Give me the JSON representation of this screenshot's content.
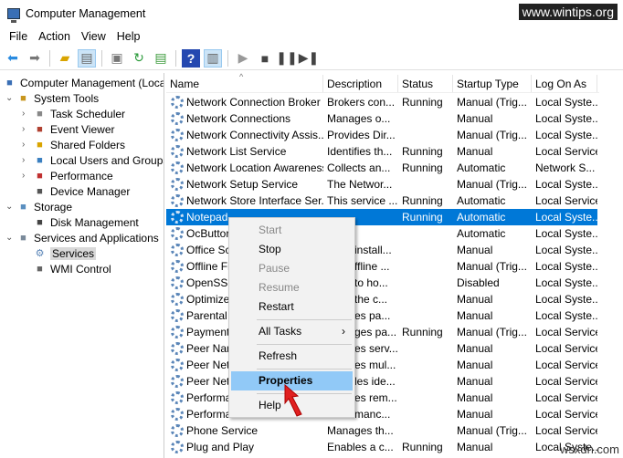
{
  "window": {
    "title": "Computer Management",
    "watermark": "www.wintips.org",
    "watermark2": "wsxdn.com"
  },
  "menubar": [
    "File",
    "Action",
    "View",
    "Help"
  ],
  "toolbar": [
    "back-icon",
    "forward-icon",
    "up-folder-icon",
    "show-hide-tree-icon",
    "export-icon",
    "refresh-icon",
    "export-list-icon",
    "help-icon",
    "show-action-pane-icon",
    "play-icon",
    "stop-icon",
    "pause-icon",
    "restart-icon"
  ],
  "tree": [
    {
      "label": "Computer Management (Local",
      "level": 0,
      "icon": "computer-icon"
    },
    {
      "label": "System Tools",
      "level": 1,
      "expanded": true,
      "icon": "tools-icon"
    },
    {
      "label": "Task Scheduler",
      "level": 2,
      "icon": "clock-icon"
    },
    {
      "label": "Event Viewer",
      "level": 2,
      "icon": "event-viewer-icon"
    },
    {
      "label": "Shared Folders",
      "level": 2,
      "icon": "shared-folder-icon"
    },
    {
      "label": "Local Users and Groups",
      "level": 2,
      "icon": "users-icon"
    },
    {
      "label": "Performance",
      "level": 2,
      "icon": "performance-icon"
    },
    {
      "label": "Device Manager",
      "level": 2,
      "icon": "device-manager-icon"
    },
    {
      "label": "Storage",
      "level": 1,
      "expanded": true,
      "icon": "storage-icon"
    },
    {
      "label": "Disk Management",
      "level": 2,
      "icon": "disk-icon"
    },
    {
      "label": "Services and Applications",
      "level": 1,
      "expanded": true,
      "icon": "services-apps-icon"
    },
    {
      "label": "Services",
      "level": 2,
      "selected": true,
      "icon": "gear-icon"
    },
    {
      "label": "WMI Control",
      "level": 2,
      "icon": "wmi-icon"
    }
  ],
  "columns": [
    "Name",
    "Description",
    "Status",
    "Startup Type",
    "Log On As"
  ],
  "rows": [
    [
      "Network Connection Broker",
      "Brokers con...",
      "Running",
      "Manual (Trig...",
      "Local Syste..."
    ],
    [
      "Network Connections",
      "Manages o...",
      "",
      "Manual",
      "Local Syste..."
    ],
    [
      "Network Connectivity Assis...",
      "Provides Dir...",
      "",
      "Manual (Trig...",
      "Local Syste..."
    ],
    [
      "Network List Service",
      "Identifies th...",
      "Running",
      "Manual",
      "Local Service"
    ],
    [
      "Network Location Awareness",
      "Collects an...",
      "Running",
      "Automatic",
      "Network S..."
    ],
    [
      "Network Setup Service",
      "The Networ...",
      "",
      "Manual (Trig...",
      "Local Syste..."
    ],
    [
      "Network Store Interface Ser...",
      "This service ...",
      "Running",
      "Automatic",
      "Local Service"
    ],
    [
      "Notepad",
      "",
      "Running",
      "Automatic",
      "Local Syste..."
    ],
    [
      "OcButtor",
      "",
      "",
      "Automatic",
      "Local Syste..."
    ],
    [
      "Office  Sc",
      "install...",
      "",
      "Manual",
      "Local Syste..."
    ],
    [
      "Offline Fi",
      "ffline ...",
      "",
      "Manual (Trig...",
      "Local Syste..."
    ],
    [
      "OpenSSH",
      "to ho...",
      "",
      "Disabled",
      "Local Syste..."
    ],
    [
      "Optimize",
      "the c...",
      "",
      "Manual",
      "Local Syste..."
    ],
    [
      "Parental C",
      "es pa...",
      "",
      "Manual",
      "Local Syste..."
    ],
    [
      "Payment",
      "ges pa...",
      "Running",
      "Manual (Trig...",
      "Local Service"
    ],
    [
      "Peer Nam",
      "es serv...",
      "",
      "Manual",
      "Local Service"
    ],
    [
      "Peer Netw",
      "es mul...",
      "",
      "Manual",
      "Local Service"
    ],
    [
      "Peer Netw",
      "les ide...",
      "",
      "Manual",
      "Local Service"
    ],
    [
      "Performa",
      "es rem...",
      "",
      "Manual",
      "Local Service"
    ],
    [
      "Performa",
      "manc...",
      "",
      "Manual",
      "Local Service"
    ],
    [
      "Phone Service",
      "Manages th...",
      "",
      "Manual (Trig...",
      "Local Service"
    ],
    [
      "Plug and Play",
      "Enables a c...",
      "Running",
      "Manual",
      "Local Syste..."
    ]
  ],
  "selected_row": 7,
  "context_menu": {
    "start": "Start",
    "stop": "Stop",
    "pause": "Pause",
    "resume": "Resume",
    "restart": "Restart",
    "all_tasks": "All Tasks",
    "refresh": "Refresh",
    "properties": "Properties",
    "help": "Help"
  }
}
